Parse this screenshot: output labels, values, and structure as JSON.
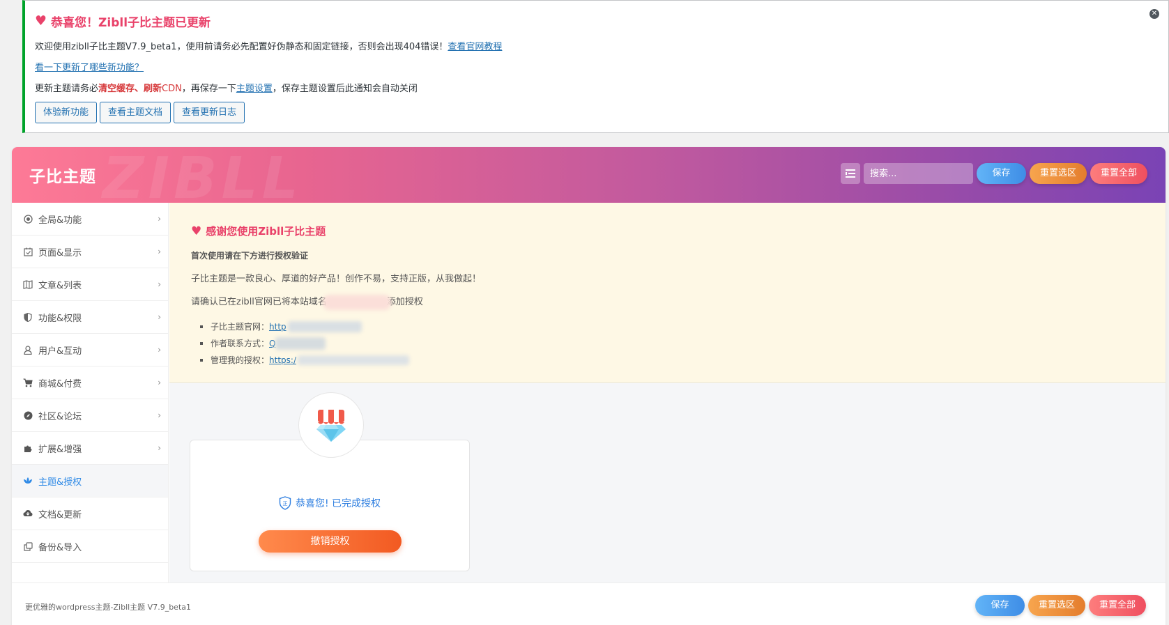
{
  "notice": {
    "title": "恭喜您！Zibll子比主题已更新",
    "line1_text": "欢迎使用zibll子比主题V7.9_beta1，使用前请务必先配置好伪静态和固定链接，否则会出现404错误！",
    "line1_link": "查看官网教程",
    "line2_link": "看一下更新了哪些新功能？",
    "line3_pre": "更新主题请务必",
    "line3_red1": "清空缓存、刷新",
    "line3_red2": "CDN",
    "line3_mid": "，再保存一下",
    "line3_link": "主题设置",
    "line3_post": "，保存主题设置后此通知会自动关闭",
    "buttons": [
      "体验新功能",
      "查看主题文档",
      "查看更新日志"
    ],
    "close_icon": "close-circle-icon",
    "accent_color": "#00a32a"
  },
  "header": {
    "brand": "子比主题",
    "watermark": "ZIBLL",
    "search_placeholder": "搜索...",
    "save_label": "保存",
    "reset_section_label": "重置选区",
    "reset_all_label": "重置全部"
  },
  "sidebar": {
    "items": [
      {
        "label": "全局&功能",
        "icon": "target-icon"
      },
      {
        "label": "页面&显示",
        "icon": "calendar-check-icon"
      },
      {
        "label": "文章&列表",
        "icon": "map-icon"
      },
      {
        "label": "功能&权限",
        "icon": "shield-icon"
      },
      {
        "label": "用户&互动",
        "icon": "user-icon"
      },
      {
        "label": "商城&付费",
        "icon": "cart-icon"
      },
      {
        "label": "社区&论坛",
        "icon": "compass-icon"
      },
      {
        "label": "扩展&增强",
        "icon": "puzzle-icon"
      },
      {
        "label": "主题&授权",
        "icon": "lotus-icon",
        "active": true
      },
      {
        "label": "文档&更新",
        "icon": "cloud-download-icon"
      },
      {
        "label": "备份&导入",
        "icon": "copy-icon"
      }
    ]
  },
  "welcome": {
    "title": "感谢您使用Zibll子比主题",
    "bold_line": "首次使用请在下方进行授权验证",
    "line1": "子比主题是一款良心、厚道的好产品！创作不易，支持正版，从我做起！",
    "line2_pre": "请确认已在zibll官网已将本站域名",
    "line2_post": "添加授权",
    "list": [
      {
        "label": "子比主题官网：",
        "link": "http"
      },
      {
        "label": "作者联系方式：",
        "link": "Q"
      },
      {
        "label": "管理我的授权：",
        "link": "https:/"
      }
    ]
  },
  "auth": {
    "status": "恭喜您! 已完成授权",
    "revoke_label": "撤销授权"
  },
  "footer": {
    "text": "更优雅的wordpress主题-Zibll主题 V7.9_beta1",
    "save_label": "保存",
    "reset_section_label": "重置选区",
    "reset_all_label": "重置全部"
  }
}
